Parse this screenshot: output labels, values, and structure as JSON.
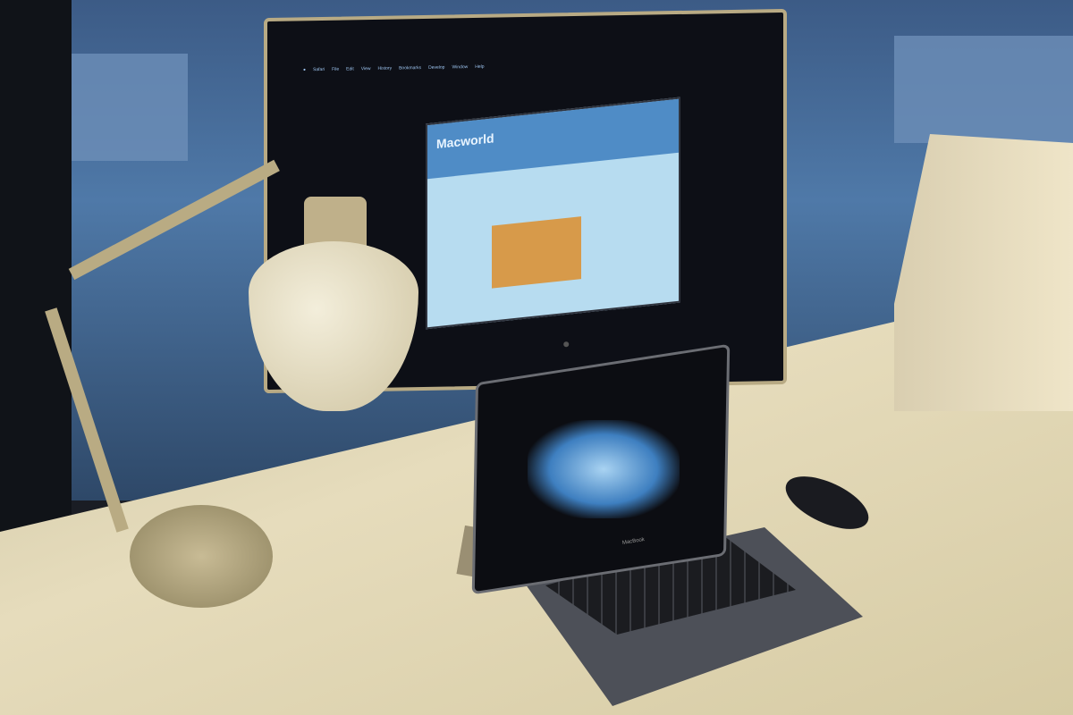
{
  "monitor": {
    "menu_bar": [
      "Safari",
      "File",
      "Edit",
      "View",
      "History",
      "Bookmarks",
      "Develop",
      "Window",
      "Help"
    ],
    "browser_site_logo": "Macworld"
  },
  "laptop": {
    "label": "MacBook"
  },
  "colors": {
    "site_header": "#4f8cc6",
    "page_bg": "#b7dcf0",
    "desk": "#e6dcbc",
    "window_light": "#4f79a8"
  }
}
